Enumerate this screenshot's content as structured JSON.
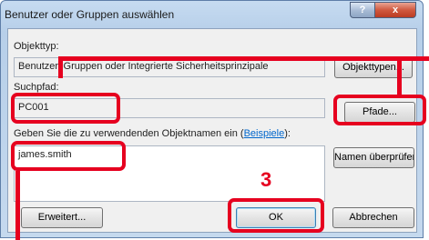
{
  "dialog": {
    "title": "Benutzer oder Gruppen auswählen",
    "help_label": "?",
    "close_label": "x"
  },
  "object_type": {
    "label": "Objekttyp:",
    "value": "Benutzer, Gruppen oder Integrierte Sicherheitsprinzipale",
    "button_label": "Objekttypen..."
  },
  "search_path": {
    "label": "Suchpfad:",
    "value": "PC001",
    "button_label": "Pfade..."
  },
  "names": {
    "label_prefix": "Geben Sie die zu verwendenden Objektnamen ein (",
    "examples_link": "Beispiele",
    "label_suffix": "):",
    "value": "james.smith",
    "check_button_label": "Namen überprüfen"
  },
  "buttons": {
    "advanced": "Erweitert...",
    "ok": "OK",
    "cancel": "Abbrechen"
  },
  "annotation": {
    "step_number": "3",
    "highlight_color": "#e6001f"
  }
}
